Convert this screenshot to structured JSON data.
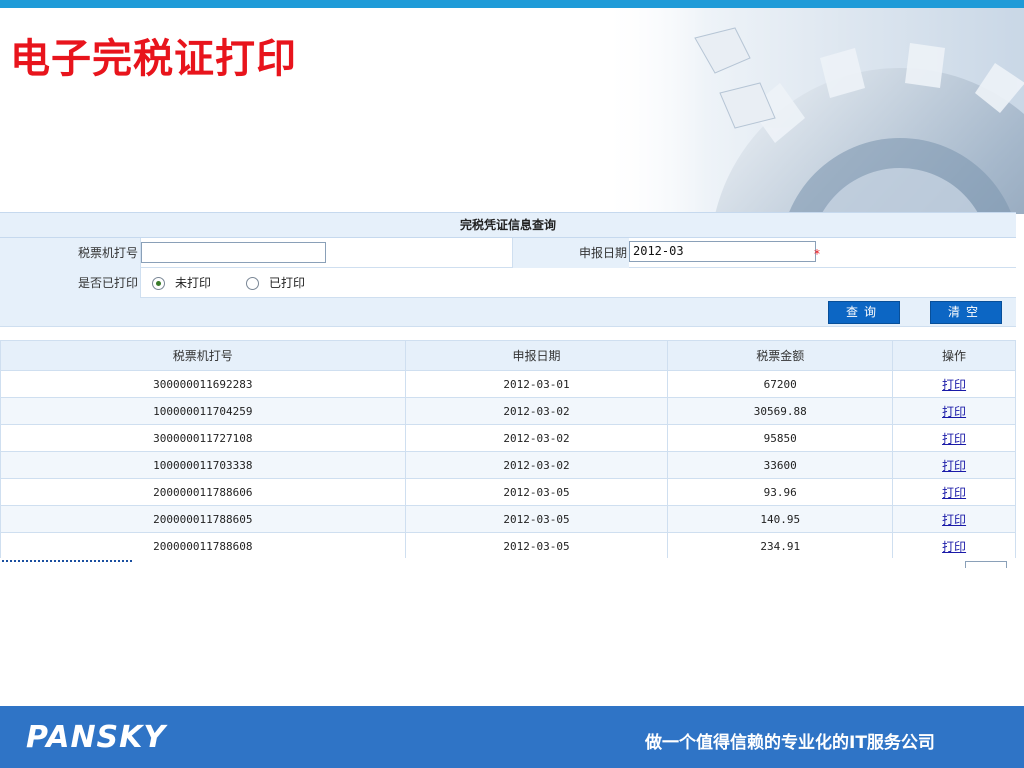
{
  "page": {
    "title": "电子完税证打印",
    "accent_color": "#e8141c",
    "brand_color": "#2f74c6"
  },
  "query": {
    "header": "完税凭证信息查询",
    "tax_machine_no_label": "税票机打号",
    "tax_machine_no_value": "",
    "declare_date_label": "申报日期",
    "declare_date_value": "2012-03",
    "required_mark": "*",
    "printed_label": "是否已打印",
    "radio_unprinted": "未打印",
    "radio_printed": "已打印",
    "radio_selected": "未打印",
    "query_button": "查询",
    "clear_button": "清空"
  },
  "table": {
    "columns": [
      "税票机打号",
      "申报日期",
      "税票金额",
      "操作"
    ],
    "rows": [
      {
        "no": "300000011692283",
        "date": "2012-03-01",
        "amount": "67200",
        "op": "打印"
      },
      {
        "no": "100000011704259",
        "date": "2012-03-02",
        "amount": "30569.88",
        "op": "打印"
      },
      {
        "no": "300000011727108",
        "date": "2012-03-02",
        "amount": "95850",
        "op": "打印"
      },
      {
        "no": "100000011703338",
        "date": "2012-03-02",
        "amount": "33600",
        "op": "打印"
      },
      {
        "no": "200000011788606",
        "date": "2012-03-05",
        "amount": "93.96",
        "op": "打印"
      },
      {
        "no": "200000011788605",
        "date": "2012-03-05",
        "amount": "140.95",
        "op": "打印"
      },
      {
        "no": "200000011788608",
        "date": "2012-03-05",
        "amount": "234.91",
        "op": "打印"
      }
    ]
  },
  "footer": {
    "logo": "PANSKY",
    "slogan": "做一个值得信赖的专业化的IT服务公司"
  }
}
